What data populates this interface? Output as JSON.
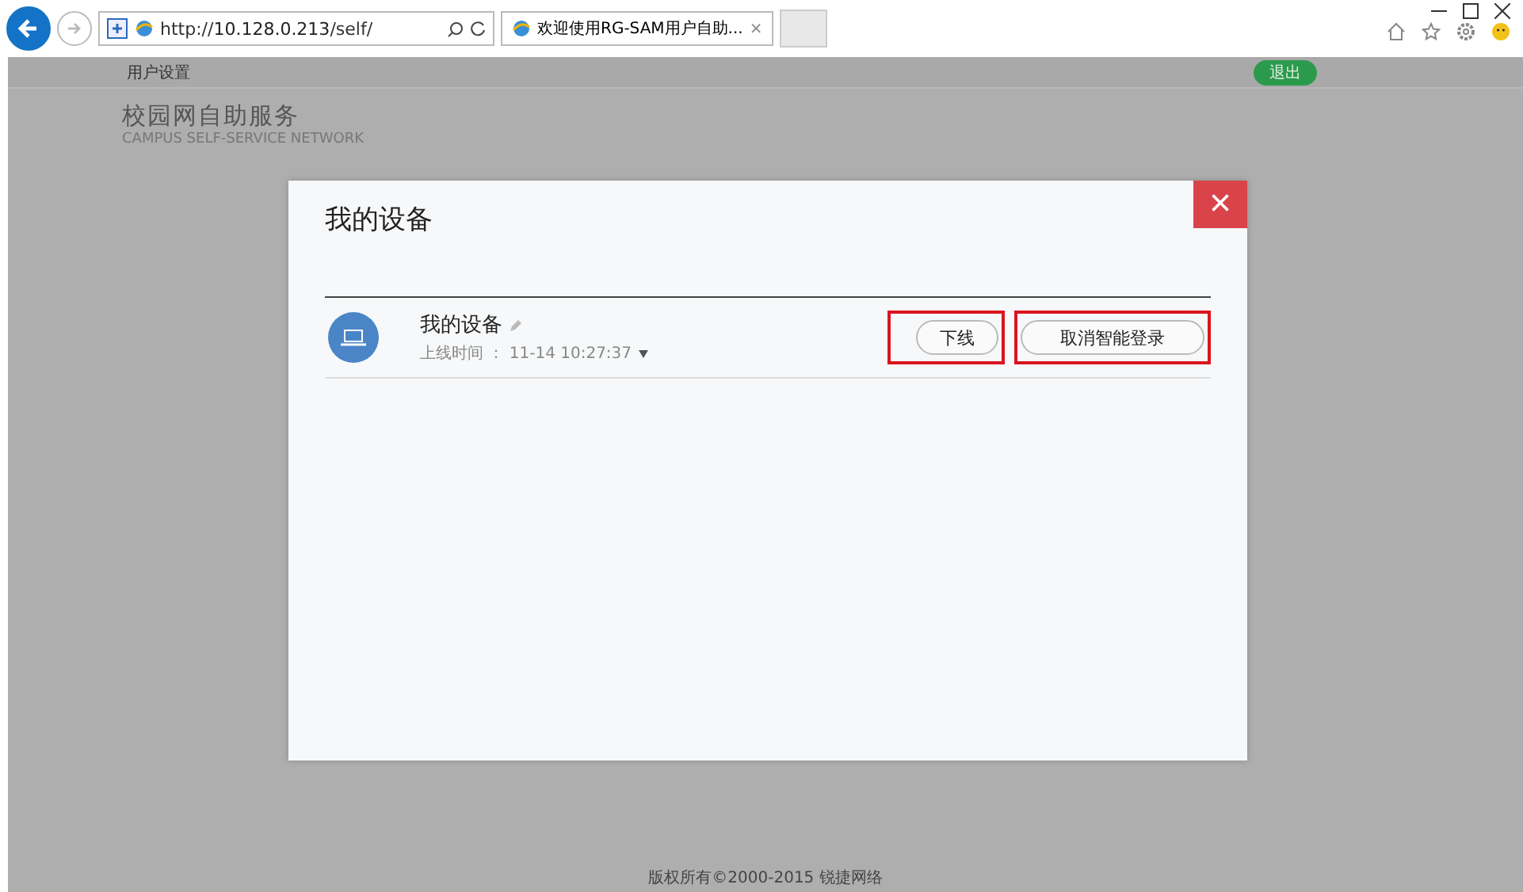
{
  "browser": {
    "url_prefix": "http://",
    "url_host": "10.128.0.213",
    "url_path": "/self/",
    "tab_title": "欢迎使用RG-SAM用户自助...",
    "tab_close": "×"
  },
  "nav": {
    "items": [
      "用户设置"
    ],
    "logout": "退出"
  },
  "brand": {
    "title": "校园网自助服务",
    "subtitle": "CAMPUS  SELF-SERVICE NETWORK"
  },
  "dialog": {
    "title": "我的设备",
    "close": "×",
    "devices": [
      {
        "name": "我的设备",
        "time_label": "上线时间 ：",
        "time": "11-14 10:27:37",
        "actions": [
          {
            "label": "下线",
            "highlighted": true
          },
          {
            "label": "取消智能登录",
            "highlighted": true
          }
        ]
      }
    ]
  },
  "footer": "版权所有©2000-2015 锐捷网络"
}
